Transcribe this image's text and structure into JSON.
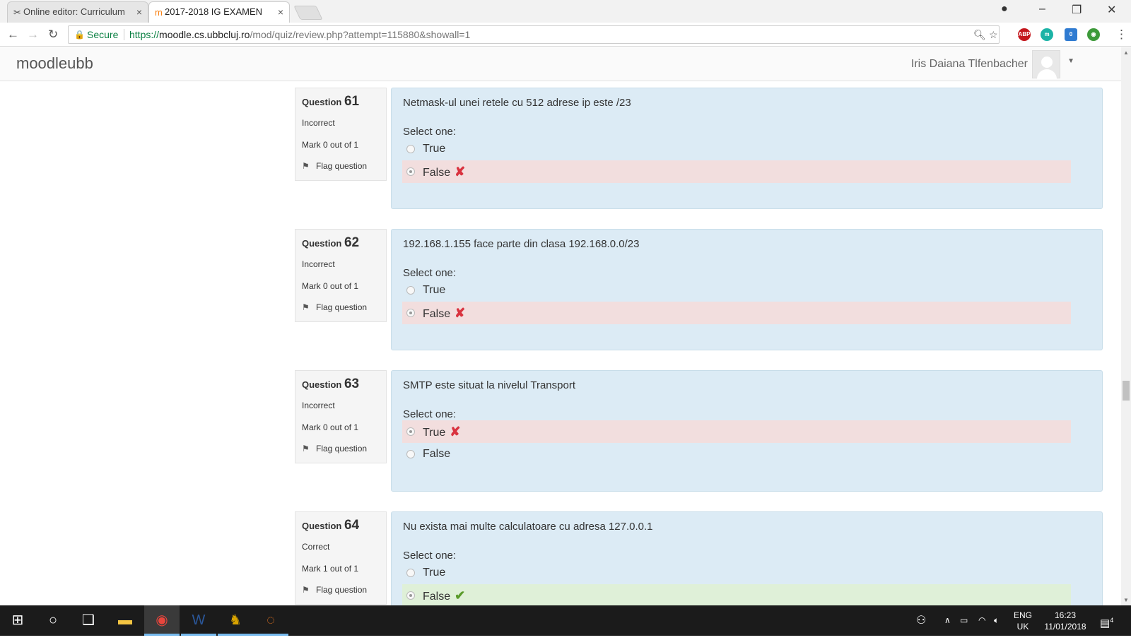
{
  "browser": {
    "tabs": [
      {
        "label": "Online editor: Curriculum",
        "active": false
      },
      {
        "label": "2017-2018 IG EXAMEN",
        "active": true
      }
    ],
    "address": {
      "secure_label": "Secure",
      "scheme": "https://",
      "host": "moodle.cs.ubbcluj.ro",
      "path": "/mod/quiz/review.php?attempt=115880&showall=1"
    },
    "extensions": [
      "ABP"
    ],
    "extension_badge": "0"
  },
  "site": {
    "brand": "moodleubb",
    "user_name": "Iris Daiana Tlfenbacher"
  },
  "questions": [
    {
      "label": "Question",
      "number": "61",
      "state": "Incorrect",
      "grade": "Mark 0 out of 1",
      "flag": "Flag question",
      "text": "Netmask-ul unei retele cu 512 adrese ip este /23",
      "prompt": "Select one:",
      "answers": [
        {
          "label": "True",
          "selected": false,
          "result": ""
        },
        {
          "label": "False",
          "selected": true,
          "result": "incorrect"
        }
      ]
    },
    {
      "label": "Question",
      "number": "62",
      "state": "Incorrect",
      "grade": "Mark 0 out of 1",
      "flag": "Flag question",
      "text": "192.168.1.155 face parte din clasa 192.168.0.0/23",
      "prompt": "Select one:",
      "answers": [
        {
          "label": "True",
          "selected": false,
          "result": ""
        },
        {
          "label": "False",
          "selected": true,
          "result": "incorrect"
        }
      ]
    },
    {
      "label": "Question",
      "number": "63",
      "state": "Incorrect",
      "grade": "Mark 0 out of 1",
      "flag": "Flag question",
      "text": "SMTP este situat la nivelul Transport",
      "prompt": "Select one:",
      "answers": [
        {
          "label": "True",
          "selected": true,
          "result": "incorrect"
        },
        {
          "label": "False",
          "selected": false,
          "result": ""
        }
      ]
    },
    {
      "label": "Question",
      "number": "64",
      "state": "Correct",
      "grade": "Mark 1 out of 1",
      "flag": "Flag question",
      "text": "Nu exista mai multe calculatoare cu adresa 127.0.0.1",
      "prompt": "Select one:",
      "answers": [
        {
          "label": "True",
          "selected": false,
          "result": ""
        },
        {
          "label": "False",
          "selected": true,
          "result": "correct"
        }
      ]
    }
  ],
  "taskbar": {
    "lang_top": "ENG",
    "lang_bottom": "UK",
    "time": "16:23",
    "date": "11/01/2018",
    "notifications": "4"
  },
  "colors": {
    "question_bg": "#dcebf5",
    "incorrect_bg": "#f2dede",
    "correct_bg": "#dff0d8",
    "incorrect_mark": "#d9333f",
    "correct_mark": "#5a9b2a"
  }
}
